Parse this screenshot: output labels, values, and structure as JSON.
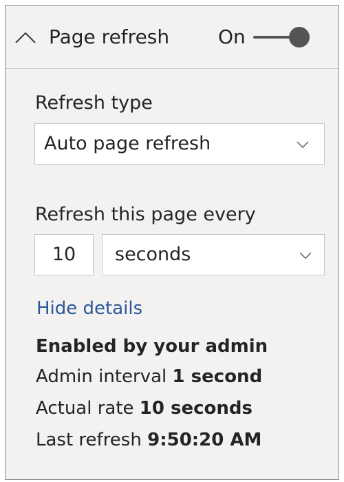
{
  "header": {
    "title": "Page refresh",
    "toggle_label": "On",
    "toggle_on": true
  },
  "refresh_type": {
    "label": "Refresh type",
    "selected": "Auto page refresh"
  },
  "interval": {
    "label": "Refresh this page every",
    "value": "10",
    "unit": "seconds"
  },
  "details_link": "Hide details",
  "details": {
    "heading": "Enabled by your admin",
    "admin_interval_label": "Admin interval",
    "admin_interval_value": "1 second",
    "actual_rate_label": "Actual rate",
    "actual_rate_value": "10 seconds",
    "last_refresh_label": "Last refresh",
    "last_refresh_value": "9:50:20 AM"
  },
  "colors": {
    "panel_bg": "#f3f2f1",
    "link": "#2b579a",
    "toggle": "#555555"
  },
  "icons": {
    "collapse": "chevron-up-icon",
    "dropdown": "chevron-down-icon"
  }
}
